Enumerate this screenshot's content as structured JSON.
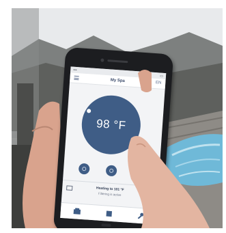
{
  "app": {
    "title": "My Spa",
    "status_bar": {
      "carrier": "•••",
      "time": "",
      "battery": "▭"
    },
    "language_indicator": "EN"
  },
  "thermostat": {
    "temperature_display": "98 °F",
    "knob_position": "upper-left"
  },
  "controls": [
    {
      "icon": "jets-icon",
      "style": "ring"
    },
    {
      "icon": "light-icon",
      "style": "ring"
    },
    {
      "icon": "blower-icon",
      "style": "solid"
    }
  ],
  "status": {
    "line1": "Heating to 101 °F",
    "line2": "Filtering is active"
  },
  "tabs": [
    {
      "icon": "home-icon"
    },
    {
      "icon": "settings-icon"
    },
    {
      "icon": "wrench-icon"
    }
  ],
  "colors": {
    "accent": "#3f5d86",
    "screen_bg": "#f3f4f6",
    "phone_body": "#1c1d20",
    "pool_water": "#6fb9d8"
  }
}
